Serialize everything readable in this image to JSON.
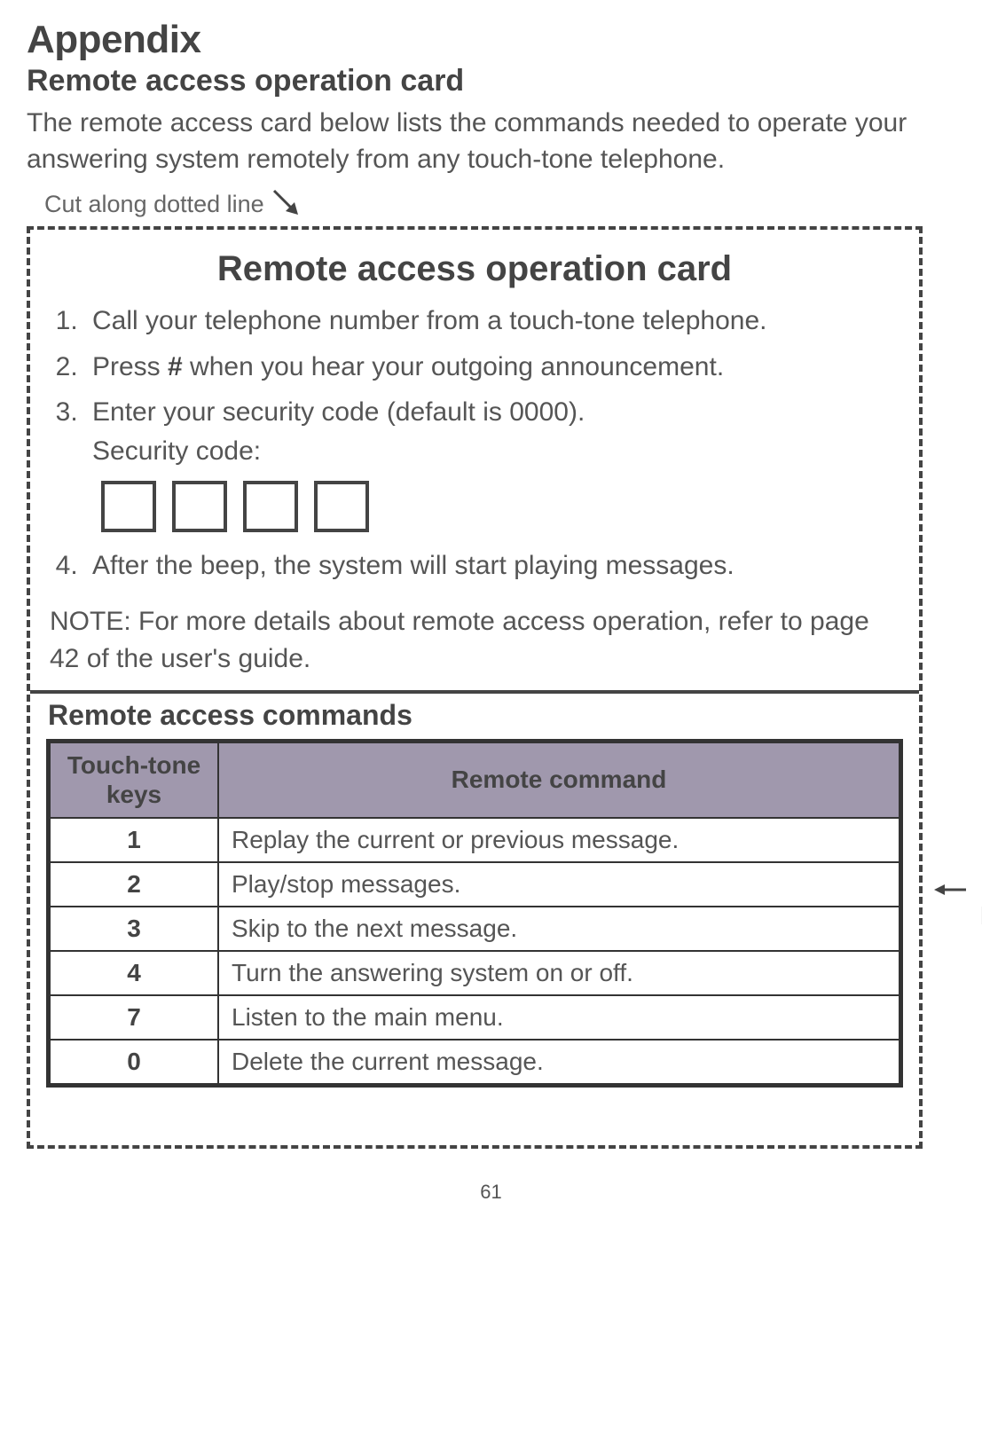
{
  "header": {
    "title": "Appendix",
    "subtitle": "Remote access operation card",
    "intro": "The remote access card below lists the commands needed to operate your answering system remotely from any touch-tone telephone."
  },
  "cut_label": "Cut along dotted line",
  "card": {
    "title": "Remote access operation card",
    "steps": [
      {
        "pre": "Call your telephone number from a touch-tone telephone.",
        "bold": "",
        "post": ""
      },
      {
        "pre": "Press ",
        "bold": "#",
        "post": " when you hear your outgoing announcement."
      },
      {
        "pre": "Enter your security code (default is 0000).",
        "bold": "",
        "post": "",
        "extra": "Security code:"
      },
      {
        "pre": "After the beep, the system will start playing messages.",
        "bold": "",
        "post": ""
      }
    ],
    "note": "NOTE: For more details about remote access operation, refer to page 42 of the user's guide.",
    "commands_title": "Remote access commands",
    "table": {
      "headers": {
        "keys": "Touch-tone keys",
        "command": "Remote command"
      },
      "rows": [
        {
          "key": "1",
          "command": "Replay the current or previous message."
        },
        {
          "key": "2",
          "command": "Play/stop messages."
        },
        {
          "key": "3",
          "command": "Skip to the next message."
        },
        {
          "key": "4",
          "command": "Turn the answering system on or off."
        },
        {
          "key": "7",
          "command": "Listen to the main menu."
        },
        {
          "key": "0",
          "command": "Delete the current message."
        }
      ]
    }
  },
  "fold_label_1": "Fold",
  "fold_label_2": "here",
  "page_number": "61"
}
